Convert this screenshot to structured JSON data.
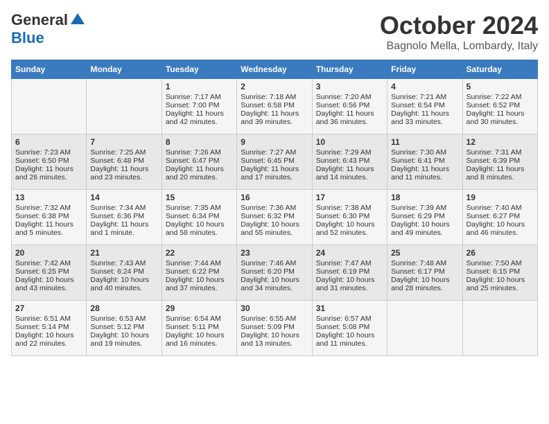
{
  "logo": {
    "general": "General",
    "blue": "Blue"
  },
  "title": "October 2024",
  "location": "Bagnolo Mella, Lombardy, Italy",
  "columns": [
    "Sunday",
    "Monday",
    "Tuesday",
    "Wednesday",
    "Thursday",
    "Friday",
    "Saturday"
  ],
  "rows": [
    [
      {
        "day": "",
        "content": ""
      },
      {
        "day": "",
        "content": ""
      },
      {
        "day": "1",
        "content": "Sunrise: 7:17 AM\nSunset: 7:00 PM\nDaylight: 11 hours and 42 minutes."
      },
      {
        "day": "2",
        "content": "Sunrise: 7:18 AM\nSunset: 6:58 PM\nDaylight: 11 hours and 39 minutes."
      },
      {
        "day": "3",
        "content": "Sunrise: 7:20 AM\nSunset: 6:56 PM\nDaylight: 11 hours and 36 minutes."
      },
      {
        "day": "4",
        "content": "Sunrise: 7:21 AM\nSunset: 6:54 PM\nDaylight: 11 hours and 33 minutes."
      },
      {
        "day": "5",
        "content": "Sunrise: 7:22 AM\nSunset: 6:52 PM\nDaylight: 11 hours and 30 minutes."
      }
    ],
    [
      {
        "day": "6",
        "content": "Sunrise: 7:23 AM\nSunset: 6:50 PM\nDaylight: 11 hours and 26 minutes."
      },
      {
        "day": "7",
        "content": "Sunrise: 7:25 AM\nSunset: 6:48 PM\nDaylight: 11 hours and 23 minutes."
      },
      {
        "day": "8",
        "content": "Sunrise: 7:26 AM\nSunset: 6:47 PM\nDaylight: 11 hours and 20 minutes."
      },
      {
        "day": "9",
        "content": "Sunrise: 7:27 AM\nSunset: 6:45 PM\nDaylight: 11 hours and 17 minutes."
      },
      {
        "day": "10",
        "content": "Sunrise: 7:29 AM\nSunset: 6:43 PM\nDaylight: 11 hours and 14 minutes."
      },
      {
        "day": "11",
        "content": "Sunrise: 7:30 AM\nSunset: 6:41 PM\nDaylight: 11 hours and 11 minutes."
      },
      {
        "day": "12",
        "content": "Sunrise: 7:31 AM\nSunset: 6:39 PM\nDaylight: 11 hours and 8 minutes."
      }
    ],
    [
      {
        "day": "13",
        "content": "Sunrise: 7:32 AM\nSunset: 6:38 PM\nDaylight: 11 hours and 5 minutes."
      },
      {
        "day": "14",
        "content": "Sunrise: 7:34 AM\nSunset: 6:36 PM\nDaylight: 11 hours and 1 minute."
      },
      {
        "day": "15",
        "content": "Sunrise: 7:35 AM\nSunset: 6:34 PM\nDaylight: 10 hours and 58 minutes."
      },
      {
        "day": "16",
        "content": "Sunrise: 7:36 AM\nSunset: 6:32 PM\nDaylight: 10 hours and 55 minutes."
      },
      {
        "day": "17",
        "content": "Sunrise: 7:38 AM\nSunset: 6:30 PM\nDaylight: 10 hours and 52 minutes."
      },
      {
        "day": "18",
        "content": "Sunrise: 7:39 AM\nSunset: 6:29 PM\nDaylight: 10 hours and 49 minutes."
      },
      {
        "day": "19",
        "content": "Sunrise: 7:40 AM\nSunset: 6:27 PM\nDaylight: 10 hours and 46 minutes."
      }
    ],
    [
      {
        "day": "20",
        "content": "Sunrise: 7:42 AM\nSunset: 6:25 PM\nDaylight: 10 hours and 43 minutes."
      },
      {
        "day": "21",
        "content": "Sunrise: 7:43 AM\nSunset: 6:24 PM\nDaylight: 10 hours and 40 minutes."
      },
      {
        "day": "22",
        "content": "Sunrise: 7:44 AM\nSunset: 6:22 PM\nDaylight: 10 hours and 37 minutes."
      },
      {
        "day": "23",
        "content": "Sunrise: 7:46 AM\nSunset: 6:20 PM\nDaylight: 10 hours and 34 minutes."
      },
      {
        "day": "24",
        "content": "Sunrise: 7:47 AM\nSunset: 6:19 PM\nDaylight: 10 hours and 31 minutes."
      },
      {
        "day": "25",
        "content": "Sunrise: 7:48 AM\nSunset: 6:17 PM\nDaylight: 10 hours and 28 minutes."
      },
      {
        "day": "26",
        "content": "Sunrise: 7:50 AM\nSunset: 6:15 PM\nDaylight: 10 hours and 25 minutes."
      }
    ],
    [
      {
        "day": "27",
        "content": "Sunrise: 6:51 AM\nSunset: 5:14 PM\nDaylight: 10 hours and 22 minutes."
      },
      {
        "day": "28",
        "content": "Sunrise: 6:53 AM\nSunset: 5:12 PM\nDaylight: 10 hours and 19 minutes."
      },
      {
        "day": "29",
        "content": "Sunrise: 6:54 AM\nSunset: 5:11 PM\nDaylight: 10 hours and 16 minutes."
      },
      {
        "day": "30",
        "content": "Sunrise: 6:55 AM\nSunset: 5:09 PM\nDaylight: 10 hours and 13 minutes."
      },
      {
        "day": "31",
        "content": "Sunrise: 6:57 AM\nSunset: 5:08 PM\nDaylight: 10 hours and 11 minutes."
      },
      {
        "day": "",
        "content": ""
      },
      {
        "day": "",
        "content": ""
      }
    ]
  ]
}
